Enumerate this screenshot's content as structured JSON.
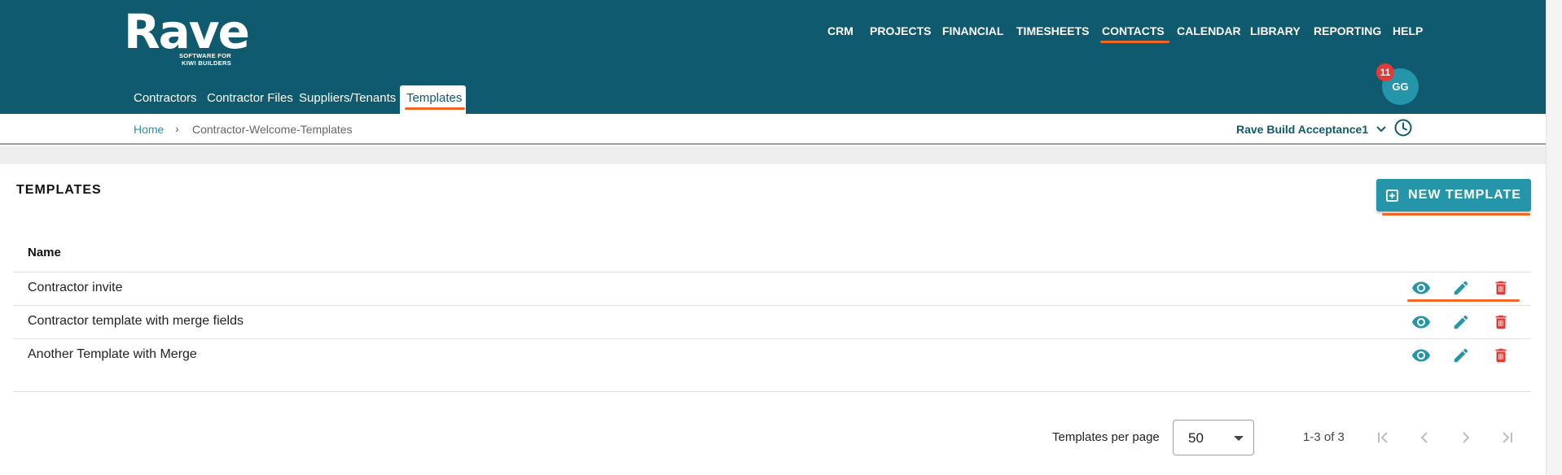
{
  "brand": {
    "logo_word": "Rave",
    "tagline_line1": "SOFTWARE FOR",
    "tagline_line2": "KIWI BUILDERS",
    "header_color": "#0f5a6e",
    "accent_color": "#2596aa",
    "highlight_color": "#f26522",
    "danger_color": "#e53935"
  },
  "main_nav": [
    {
      "label": "CRM",
      "active": false
    },
    {
      "label": "PROJECTS",
      "active": false
    },
    {
      "label": "FINANCIAL",
      "active": false
    },
    {
      "label": "TIMESHEETS",
      "active": false
    },
    {
      "label": "CONTACTS",
      "active": true
    },
    {
      "label": "CALENDAR",
      "active": false
    },
    {
      "label": "LIBRARY",
      "active": false
    },
    {
      "label": "REPORTING",
      "active": false
    },
    {
      "label": "HELP",
      "active": false
    }
  ],
  "sub_nav": [
    {
      "label": "Contractors",
      "active": false
    },
    {
      "label": "Contractor Files",
      "active": false
    },
    {
      "label": "Suppliers/Tenants",
      "active": false
    },
    {
      "label": "Templates",
      "active": true
    }
  ],
  "user": {
    "initials": "GG",
    "notification_count": "11"
  },
  "breadcrumb": {
    "home": "Home",
    "separator": "›",
    "current": "Contractor-Welcome-Templates"
  },
  "project_selector": {
    "value": "Rave Build Acceptance1",
    "icon": "chevron-down-icon"
  },
  "page": {
    "title": "TEMPLATES",
    "new_button_label": "NEW TEMPLATE",
    "new_button_icon": "add-box-icon"
  },
  "table": {
    "column_header": "Name",
    "rows": [
      {
        "name": "Contractor invite"
      },
      {
        "name": "Contractor template with merge fields"
      },
      {
        "name": "Another Template with Merge"
      }
    ],
    "row_actions": [
      "eye-icon",
      "pencil-icon",
      "trash-icon"
    ]
  },
  "pagination": {
    "per_page_label": "Templates per page",
    "per_page_value": "50",
    "range": "1-3 of 3"
  }
}
